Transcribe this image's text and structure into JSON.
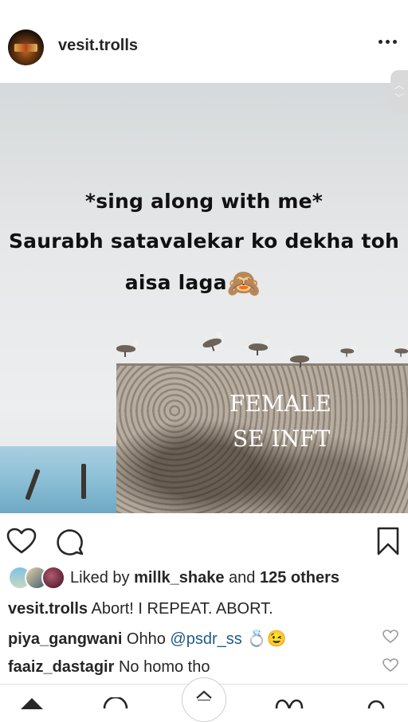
{
  "post": {
    "username": "vesit.trolls",
    "image_text": {
      "line1": "*sing along with me*",
      "line2": "Saurabh satavalekar ko dekha toh",
      "line3": "aisa laga",
      "line3_emoji": "🙈",
      "watermark_line1": "FEMALE",
      "watermark_line2": "SE INFT"
    }
  },
  "likes": {
    "prefix": "Liked by ",
    "user": "millk_shake",
    "middle": " and ",
    "count": "125 others"
  },
  "comments": [
    {
      "user": "vesit.trolls",
      "text": " Abort! I REPEAT. ABORT."
    },
    {
      "user": "piya_gangwani",
      "text": " Ohho ",
      "mention": "@psdr_ss",
      "emoji": "💍😉"
    },
    {
      "user": "faaiz_dastagir",
      "text": " No homo tho"
    }
  ],
  "icons": {
    "more": "more-options-icon",
    "like": "heart-icon",
    "comment": "comment-icon",
    "save": "bookmark-icon",
    "scroll": "scroll-arrows-icon",
    "home": "home-icon",
    "search": "search-icon",
    "activity": "heart-icon",
    "profile": "profile-icon",
    "up": "chevron-up-icon"
  }
}
